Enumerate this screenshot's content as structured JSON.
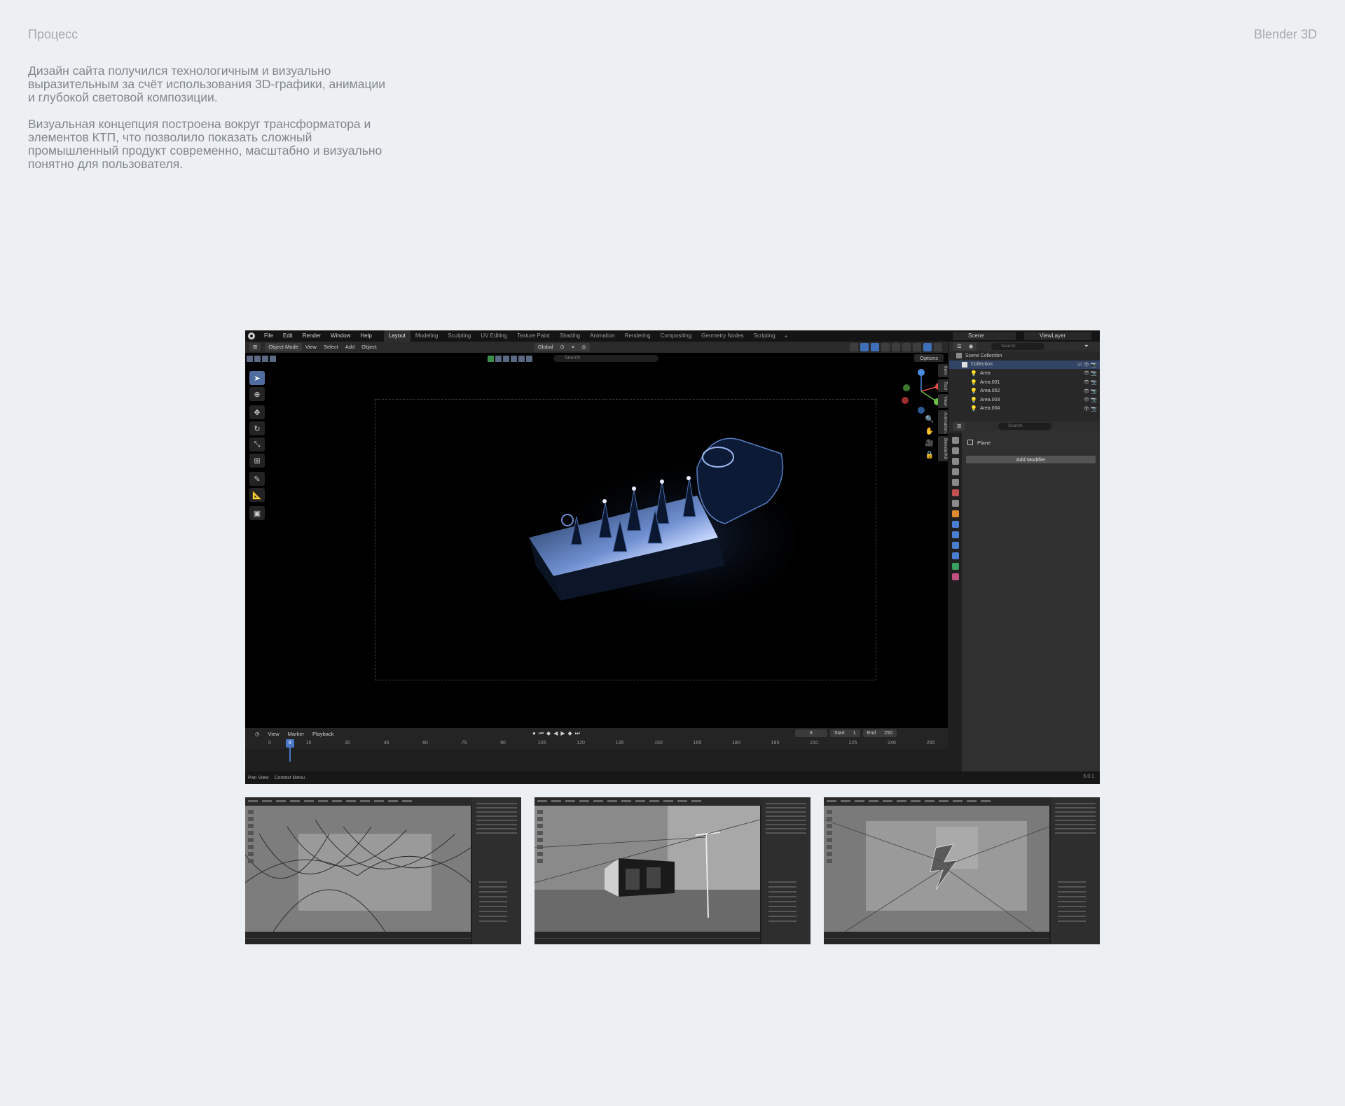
{
  "page": {
    "section_label": "Процесс",
    "tool_label": "Blender 3D",
    "paragraphs": [
      "Дизайн сайта получился технологичным и визуально выразительным за счёт использования 3D-графики, анимации и глубокой световой композиции.",
      "Визуальная концепция построена вокруг трансформатора и элементов КТП, что позволило показать сложный промышленный продукт современно, масштабно и визуально понятно для пользователя."
    ]
  },
  "blender": {
    "menu": [
      "File",
      "Edit",
      "Render",
      "Window",
      "Help"
    ],
    "workspaces": [
      "Layout",
      "Modeling",
      "Sculpting",
      "UV Editing",
      "Texture Paint",
      "Shading",
      "Animation",
      "Rendering",
      "Compositing",
      "Geometry Nodes",
      "Scripting"
    ],
    "active_workspace": "Layout",
    "scene": "Scene",
    "view_layer": "ViewLayer",
    "header": {
      "mode": "Object Mode",
      "view": "View",
      "select": "Select",
      "add": "Add",
      "object": "Object",
      "transform": "Global"
    },
    "viewport": {
      "search_placeholder": "Search",
      "options": "Options",
      "side_tabs": [
        "Item",
        "Tool",
        "View",
        "Animation",
        "BlenderKit"
      ]
    },
    "timeline": {
      "view": "View",
      "marker": "Marker",
      "playback": "Playback",
      "current_frame": "8",
      "start_label": "Start",
      "start": "1",
      "end_label": "End",
      "end": "250",
      "ticks": [
        "0",
        "15",
        "30",
        "45",
        "60",
        "75",
        "90",
        "105",
        "120",
        "135",
        "150",
        "165",
        "180",
        "195",
        "210",
        "225",
        "240",
        "255"
      ]
    },
    "status": {
      "pan_view": "Pan View",
      "context_menu": "Context Menu",
      "version": "5.0.1"
    },
    "outliner": {
      "search_placeholder": "Search",
      "scene_collection": "Scene Collection",
      "collection": "Collection",
      "items": [
        "Area",
        "Area.001",
        "Area.002",
        "Area.003",
        "Area.004"
      ]
    },
    "properties": {
      "search_placeholder": "Search",
      "object_name": "Plane",
      "add_modifier": "Add Modifier"
    }
  }
}
